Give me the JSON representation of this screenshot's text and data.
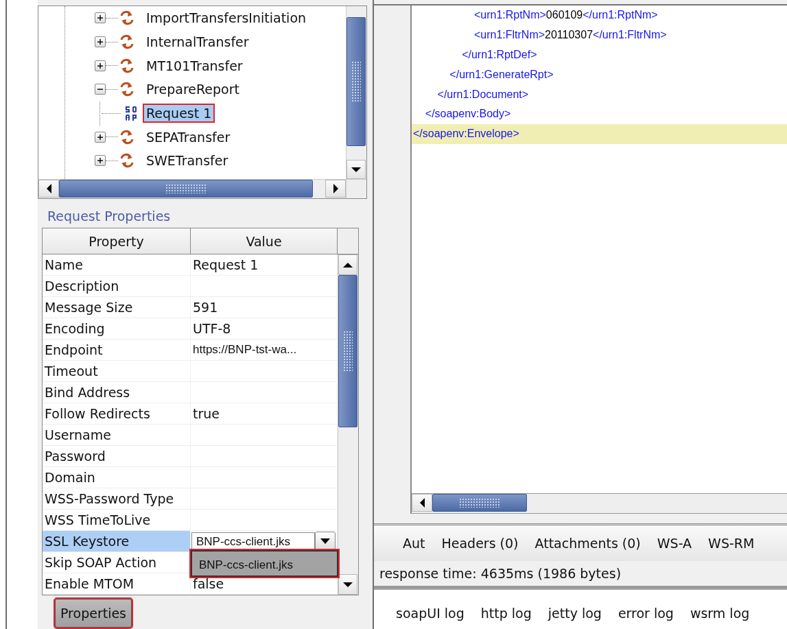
{
  "tree": {
    "items": [
      {
        "label": "ImportTransfersInitiation",
        "kind": "operation",
        "expanded": false,
        "selected": false,
        "outlined": false
      },
      {
        "label": "InternalTransfer",
        "kind": "operation",
        "expanded": false,
        "selected": false,
        "outlined": false
      },
      {
        "label": "MT101Transfer",
        "kind": "operation",
        "expanded": false,
        "selected": false,
        "outlined": false
      },
      {
        "label": "PrepareReport",
        "kind": "operation",
        "expanded": true,
        "selected": false,
        "outlined": false,
        "children": [
          {
            "label": "Request 1",
            "kind": "request",
            "selected": true,
            "outlined": true
          }
        ]
      },
      {
        "label": "SEPATransfer",
        "kind": "operation",
        "expanded": false,
        "selected": false,
        "outlined": false
      },
      {
        "label": "SWETransfer",
        "kind": "operation",
        "expanded": false,
        "selected": false,
        "outlined": false
      }
    ]
  },
  "properties": {
    "title": "Request Properties",
    "columns": [
      "Property",
      "Value"
    ],
    "rows": [
      {
        "property": "Name",
        "value": "Request 1",
        "kind": "text",
        "selected": false
      },
      {
        "property": "Description",
        "kind": "text",
        "selected": false
      },
      {
        "property": "Message Size",
        "value": "591",
        "kind": "text",
        "selected": false
      },
      {
        "property": "Encoding",
        "value": "UTF-8",
        "kind": "text",
        "selected": false
      },
      {
        "property": "Endpoint",
        "value": "https://BNP-tst-wa...",
        "kind": "url",
        "selected": false
      },
      {
        "property": "Timeout",
        "kind": "text",
        "selected": false
      },
      {
        "property": "Bind Address",
        "kind": "text",
        "selected": false
      },
      {
        "property": "Follow Redirects",
        "value": "true",
        "kind": "text",
        "selected": false
      },
      {
        "property": "Username",
        "kind": "text",
        "selected": false
      },
      {
        "property": "Password",
        "kind": "text",
        "selected": false
      },
      {
        "property": "Domain",
        "kind": "text",
        "selected": false
      },
      {
        "property": "WSS-Password Type",
        "kind": "text",
        "selected": false
      },
      {
        "property": "WSS TimeToLive",
        "kind": "text",
        "selected": false
      },
      {
        "property": "SSL Keystore",
        "value": "BNP-ccs-client.jks",
        "kind": "combo",
        "selected": true
      },
      {
        "property": "Skip SOAP Action",
        "kind": "text",
        "selected": false
      },
      {
        "property": "Enable MTOM",
        "value": "false",
        "kind": "text",
        "selected": false
      }
    ],
    "dropdown": {
      "option": "BNP-ccs-client.jks",
      "outlined": true
    },
    "button": {
      "label": "Properties",
      "outlined": true
    }
  },
  "editor": {
    "lines": [
      {
        "current": false,
        "parts": [
          {
            "kind": "tag",
            "text": "                    <urn1:RptNm>"
          },
          {
            "kind": "value",
            "text": "060109"
          },
          {
            "kind": "tag",
            "text": "</urn1:RptNm>"
          }
        ]
      },
      {
        "current": false,
        "parts": [
          {
            "kind": "tag",
            "text": "                    <urn1:FltrNm>"
          },
          {
            "kind": "value",
            "text": "20110307"
          },
          {
            "kind": "tag",
            "text": "</urn1:FltrNm>"
          }
        ]
      },
      {
        "current": false,
        "parts": [
          {
            "kind": "tag",
            "text": "                </urn1:RptDef>"
          }
        ]
      },
      {
        "current": false,
        "parts": [
          {
            "kind": "tag",
            "text": "            </urn1:GenerateRpt>"
          }
        ]
      },
      {
        "current": false,
        "parts": [
          {
            "kind": "tag",
            "text": "        </urn1:Document>"
          }
        ]
      },
      {
        "current": false,
        "parts": [
          {
            "kind": "tag",
            "text": "    </soapenv:Body>"
          }
        ]
      },
      {
        "current": true,
        "parts": [
          {
            "kind": "tag",
            "text": "</soapenv:Envelope>"
          }
        ]
      }
    ]
  },
  "tabs": [
    "Aut",
    "Headers (0)",
    "Attachments (0)",
    "WS-A",
    "WS-RM"
  ],
  "status": "response time: 4635ms (1986 bytes)",
  "log_tabs": [
    "soapUI log",
    "http log",
    "jetty log",
    "error log",
    "wsrm log"
  ]
}
